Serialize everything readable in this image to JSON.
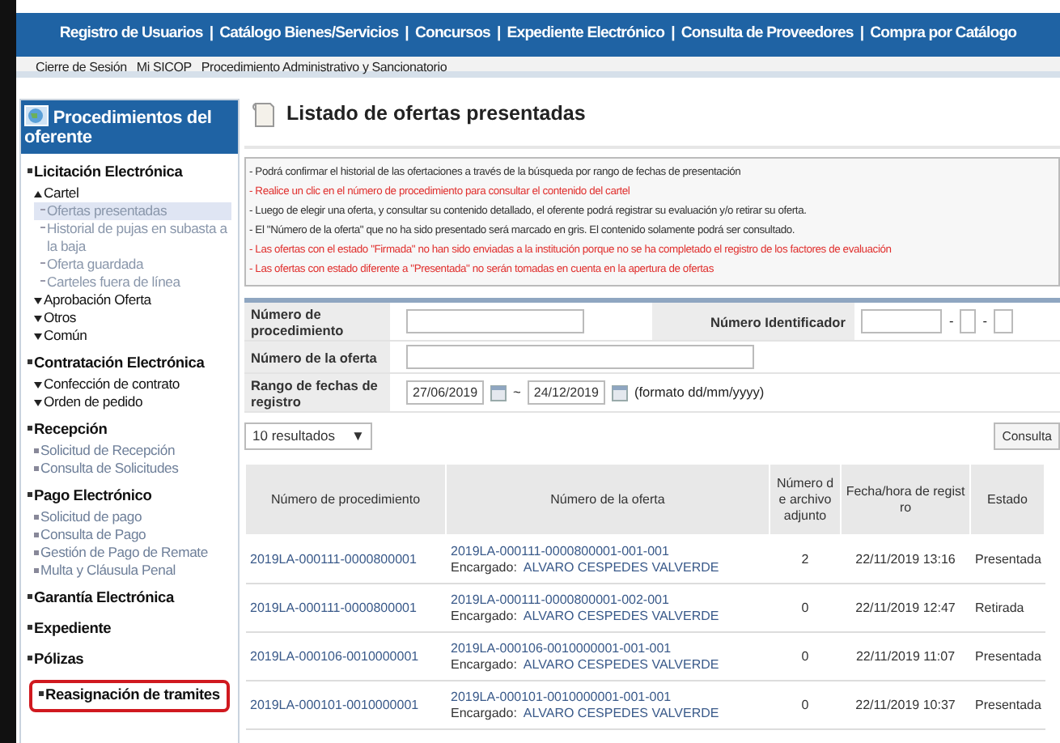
{
  "top_nav": [
    "Registro de Usuarios",
    "Catálogo Bienes/Servicios",
    "Concursos",
    "Expediente Electrónico",
    "Consulta de Proveedores",
    "Compra por Catálogo"
  ],
  "nav_separator": "|",
  "sub_nav": [
    "Cierre de Sesión",
    "Mi SICOP",
    "Procedimiento Administrativo y Sancionatorio"
  ],
  "sidebar": {
    "title": "Procedimientos del oferente",
    "items": [
      {
        "label": "Licitación Electrónica",
        "kind": "section",
        "children": [
          {
            "label": "Cartel",
            "kind": "folder",
            "expanded": true,
            "children": [
              {
                "label": "Ofertas presentadas",
                "kind": "link",
                "selected": true
              },
              {
                "label": "Historial de pujas en subasta a la baja",
                "kind": "link",
                "selected": false
              },
              {
                "label": "Oferta guardada",
                "kind": "link",
                "selected": false
              },
              {
                "label": "Carteles fuera de línea",
                "kind": "link",
                "selected": false
              }
            ]
          },
          {
            "label": "Aprobación Oferta",
            "kind": "folder",
            "expanded": false
          },
          {
            "label": "Otros",
            "kind": "folder",
            "expanded": false
          },
          {
            "label": "Común",
            "kind": "folder",
            "expanded": false
          }
        ]
      },
      {
        "label": "Contratación Electrónica",
        "kind": "section",
        "children": [
          {
            "label": "Confección de contrato",
            "kind": "folder",
            "expanded": false
          },
          {
            "label": "Orden de pedido",
            "kind": "folder",
            "expanded": false
          }
        ]
      },
      {
        "label": "Recepción",
        "kind": "section",
        "children": [
          {
            "label": "Solicitud de Recepción",
            "kind": "link",
            "selected": false
          },
          {
            "label": "Consulta de Solicitudes",
            "kind": "link",
            "selected": false
          }
        ]
      },
      {
        "label": "Pago Electrónico",
        "kind": "section",
        "children": [
          {
            "label": "Solicitud de pago",
            "kind": "link",
            "selected": false
          },
          {
            "label": "Consulta de Pago",
            "kind": "link",
            "selected": false
          },
          {
            "label": "Gestión de Pago de Remate",
            "kind": "link",
            "selected": false
          },
          {
            "label": "Multa y Cláusula Penal",
            "kind": "link",
            "selected": false
          }
        ]
      },
      {
        "label": "Garantía Electrónica",
        "kind": "section"
      },
      {
        "label": "Expediente",
        "kind": "section"
      },
      {
        "label": "Pólizas",
        "kind": "section"
      },
      {
        "label": "Reasignación de tramites",
        "kind": "section",
        "outlined": true
      }
    ]
  },
  "page_title": "Listado de ofertas presentadas",
  "notes": [
    {
      "text": "- Podrá confirmar el historial de las ofertaciones a través de la búsqueda por rango de fechas de presentación",
      "color": "#333333"
    },
    {
      "text": "- Realice un clic en el número de procedimiento para consultar el contenido del cartel",
      "color": "#e0302e"
    },
    {
      "text": "- Luego de elegir una oferta, y consultar su contenido detallado, el oferente podrá registrar su evaluación y/o retirar su oferta.",
      "color": "#333333"
    },
    {
      "text": "- El \"Número de la oferta\" que no ha sido presentado será marcado en gris. El contenido solamente podrá ser consultado.",
      "color": "#333333"
    },
    {
      "text": "- Las ofertas con el estado \"Firmada\" no han sido enviadas a la institución porque no se ha completado el registro de los factores de evaluación",
      "color": "#e0302e"
    },
    {
      "text": "- Las ofertas con estado diferente a \"Presentada\" no serán tomadas en cuenta en la apertura de ofertas",
      "color": "#e0302e"
    }
  ],
  "form": {
    "procedure_label": "Número de procedimiento",
    "identifier_label": "Número Identificador",
    "identifier_separator": "-",
    "offer_label": "Número de la oferta",
    "date_label": "Rango de fechas de registro",
    "date_from": "27/06/2019",
    "date_separator": "~",
    "date_to": "24/12/2019",
    "date_hint": "(formato dd/mm/yyyy)"
  },
  "results_select": "10 resultados",
  "results_caret": "▼",
  "consult_button": "Consulta",
  "table": {
    "columns": [
      "Número de procedimiento",
      "Número de la oferta",
      "Número de archivo adjunto",
      "Fecha/hora de registro",
      "Estado"
    ],
    "rows": [
      {
        "procedure": "2019LA-000111-0000800001",
        "offer": "2019LA-000111-0000800001-001-001",
        "manager_label": "Encargado:",
        "manager": "ALVARO CESPEDES VALVERDE",
        "attachments": "2",
        "date": "22/11/2019 13:16",
        "status": "Presentada"
      },
      {
        "procedure": "2019LA-000111-0000800001",
        "offer": "2019LA-000111-0000800001-002-001",
        "manager_label": "Encargado:",
        "manager": "ALVARO CESPEDES VALVERDE",
        "attachments": "0",
        "date": "22/11/2019 12:47",
        "status": "Retirada"
      },
      {
        "procedure": "2019LA-000106-0010000001",
        "offer": "2019LA-000106-0010000001-001-001",
        "manager_label": "Encargado:",
        "manager": "ALVARO CESPEDES VALVERDE",
        "attachments": "0",
        "date": "22/11/2019 11:07",
        "status": "Presentada"
      },
      {
        "procedure": "2019LA-000101-0010000001",
        "offer": "2019LA-000101-0010000001-001-001",
        "manager_label": "Encargado:",
        "manager": "ALVARO CESPEDES VALVERDE",
        "attachments": "0",
        "date": "22/11/2019 10:37",
        "status": "Presentada"
      }
    ]
  }
}
